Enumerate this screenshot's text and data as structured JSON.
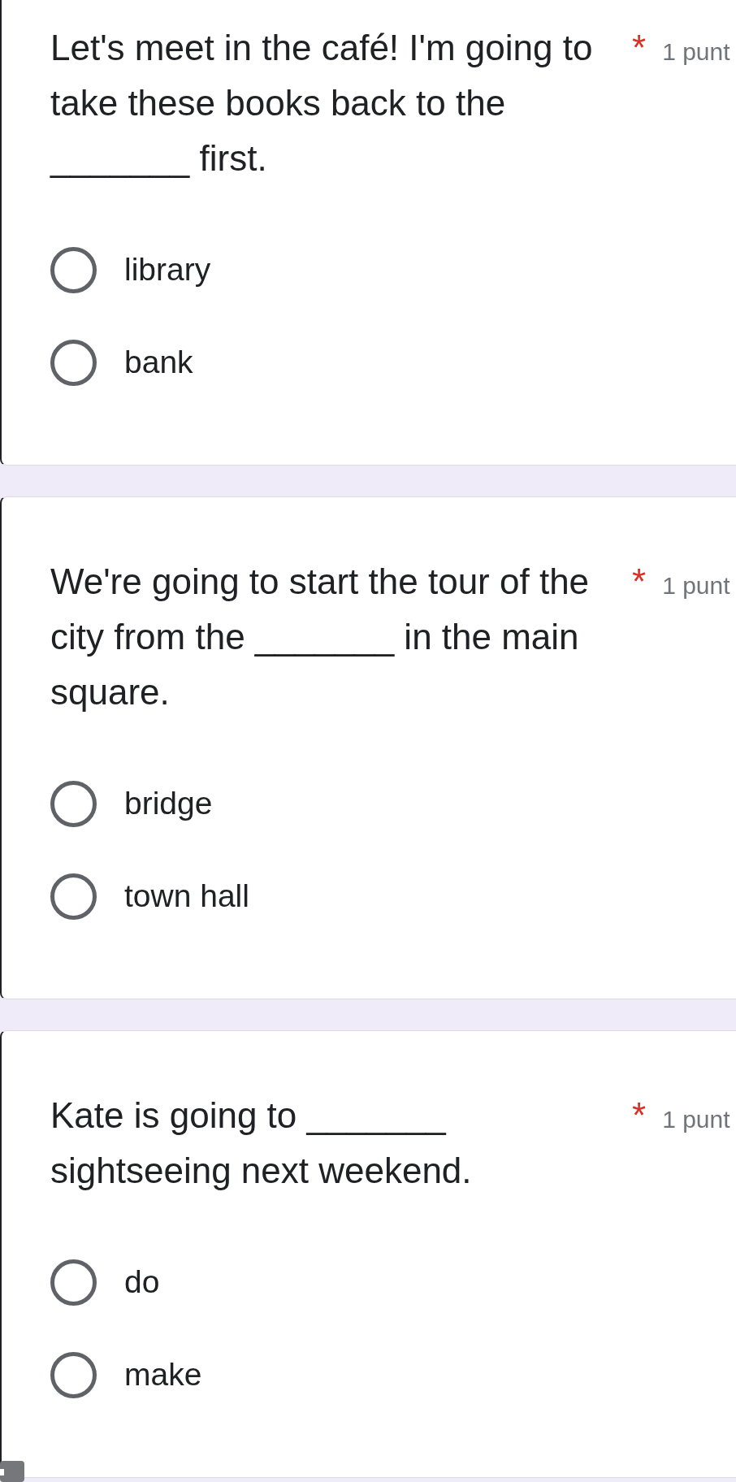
{
  "questions": [
    {
      "title": "Let's meet in the café! I'm going to take these books back to the _______ first.",
      "required_mark": "*",
      "points": "1 punt",
      "options": [
        {
          "label": "library",
          "selected": false
        },
        {
          "label": "bank",
          "selected": false
        }
      ]
    },
    {
      "title": "We're going to start the tour of the city from the _______ in the main square.",
      "required_mark": "*",
      "points": "1 punt",
      "options": [
        {
          "label": "bridge",
          "selected": false
        },
        {
          "label": "town hall",
          "selected": false
        }
      ]
    },
    {
      "title": "Kate is going to _______ sightseeing next weekend.",
      "required_mark": "*",
      "points": "1 punt",
      "options": [
        {
          "label": "do",
          "selected": false
        },
        {
          "label": "make",
          "selected": false
        }
      ]
    }
  ]
}
